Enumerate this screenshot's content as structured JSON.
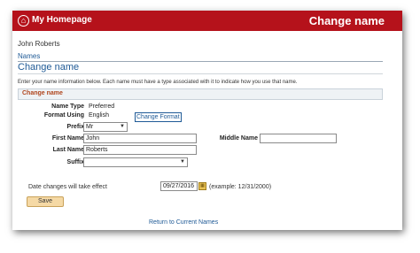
{
  "header": {
    "home_icon": "home-icon",
    "home_title": "My Homepage",
    "page_heading": "Change  name"
  },
  "user_name": "John Roberts",
  "breadcrumb": {
    "names_link": "Names"
  },
  "subtitle": "Change  name",
  "instructions": "Enter your name information below. Each name must have a type associated with it to indicate how you use that name.",
  "section": {
    "title": "Change name"
  },
  "form": {
    "name_type": {
      "label": "Name Type",
      "value": "Preferred"
    },
    "format_using": {
      "label": "Format Using",
      "value": "English",
      "change_link": "Change Format"
    },
    "prefix": {
      "label": "Prefix",
      "value": "Mr"
    },
    "first_name": {
      "label": "First Name",
      "value": "John"
    },
    "middle_name": {
      "label": "Middle Name",
      "value": ""
    },
    "last_name": {
      "label": "Last Name",
      "value": "Roberts"
    },
    "suffix": {
      "label": "Suffix",
      "value": ""
    }
  },
  "effective_date": {
    "label": "Date changes will take effect",
    "value": "09/27/2016",
    "example": "(example: 12/31/2000)",
    "calendar_icon": "calendar-icon"
  },
  "save_button": "Save",
  "return_link": "Return to Current Names",
  "colors": {
    "brand": "#b5121b",
    "link": "#1f5a96",
    "section_title": "#b0451d",
    "button": "#f5d9a5"
  }
}
